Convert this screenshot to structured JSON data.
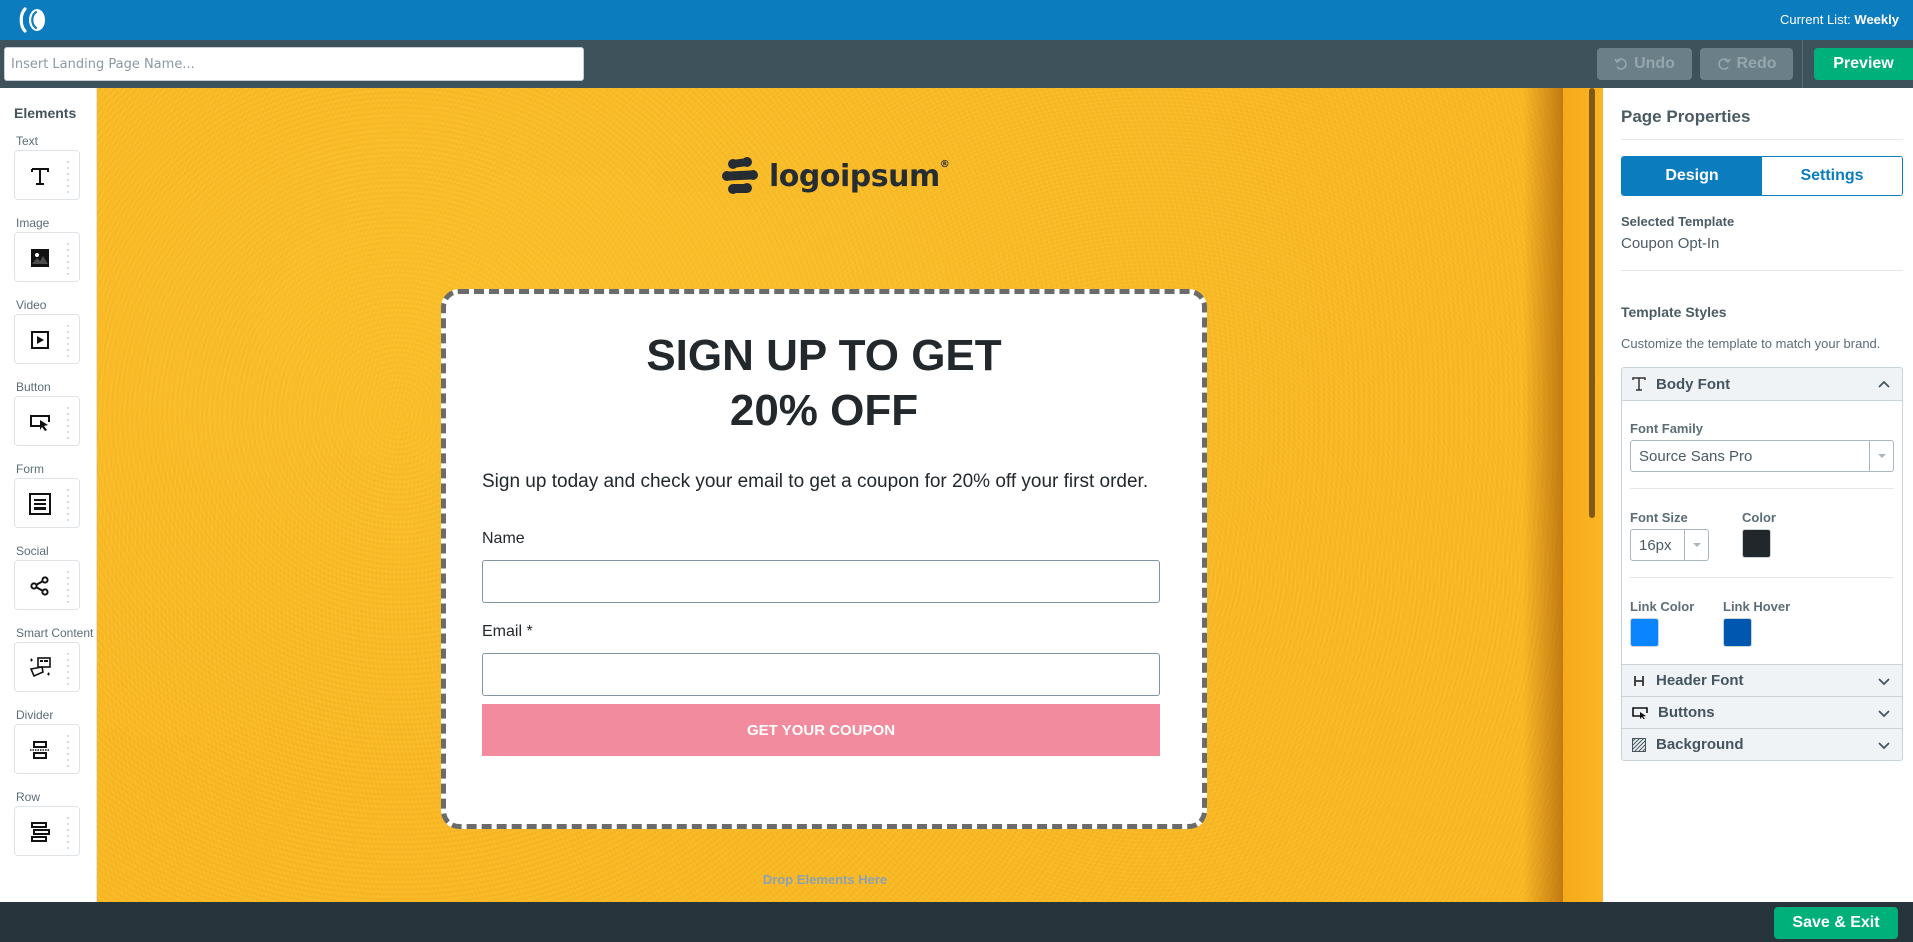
{
  "topbar": {
    "brand_icon": "brand-logo-icon",
    "current_list_label": "Current List:",
    "current_list_value": "Weekly"
  },
  "toolbar": {
    "page_name_value": "",
    "page_name_placeholder": "Insert Landing Page Name...",
    "undo_label": "Undo",
    "redo_label": "Redo",
    "preview_label": "Preview"
  },
  "elements_panel": {
    "title": "Elements",
    "items": [
      {
        "label": "Text",
        "icon": "text-icon"
      },
      {
        "label": "Image",
        "icon": "image-icon"
      },
      {
        "label": "Video",
        "icon": "video-icon"
      },
      {
        "label": "Button",
        "icon": "button-icon"
      },
      {
        "label": "Form",
        "icon": "form-icon"
      },
      {
        "label": "Social",
        "icon": "share-icon"
      },
      {
        "label": "Smart Content",
        "icon": "magic-hat-icon"
      },
      {
        "label": "Divider",
        "icon": "divider-icon"
      },
      {
        "label": "Row",
        "icon": "row-icon"
      }
    ]
  },
  "canvas": {
    "logo_text": "logoipsum",
    "logo_mark": "®",
    "headline_line1": "SIGN UP TO GET",
    "headline_line2": "20% OFF",
    "subtext": "Sign up today and check your email to get a coupon for 20% off your first order.",
    "form": {
      "name_label": "Name",
      "name_value": "",
      "email_label": "Email *",
      "email_value": "",
      "submit_label": "GET YOUR COUPON",
      "submit_color": "#f28b9d"
    },
    "drop_hint": "Drop Elements Here",
    "background_color": "#f9b824"
  },
  "properties": {
    "title": "Page Properties",
    "tabs": [
      {
        "label": "Design",
        "active": true
      },
      {
        "label": "Settings",
        "active": false
      }
    ],
    "selected_template_label": "Selected Template",
    "selected_template_value": "Coupon Opt-In",
    "template_styles_title": "Template Styles",
    "template_styles_desc": "Customize the template to match your brand.",
    "body_font": {
      "title": "Body Font",
      "expanded": true,
      "font_family_label": "Font Family",
      "font_family_value": "Source Sans Pro",
      "font_size_label": "Font Size",
      "font_size_value": "16px",
      "color_label": "Color",
      "color_value": "#22272b",
      "link_color_label": "Link Color",
      "link_color_value": "#0a84ff",
      "link_hover_label": "Link Hover",
      "link_hover_value": "#0057b0"
    },
    "sections": [
      {
        "title": "Header Font",
        "icon": "header-icon",
        "expanded": false
      },
      {
        "title": "Buttons",
        "icon": "button-icon",
        "expanded": false
      },
      {
        "title": "Background",
        "icon": "background-pattern-icon",
        "expanded": false
      }
    ]
  },
  "bottombar": {
    "save_exit_label": "Save & Exit"
  }
}
